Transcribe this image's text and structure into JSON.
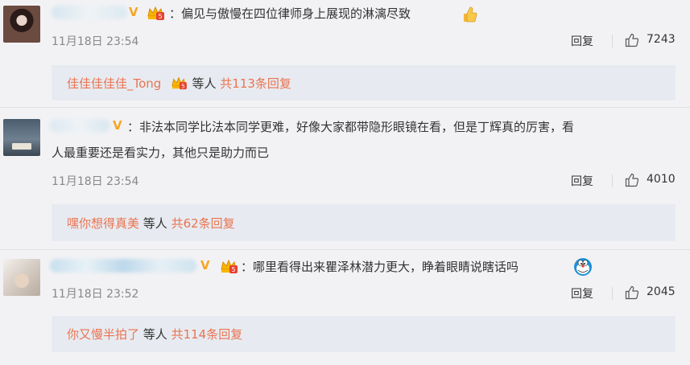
{
  "comments": [
    {
      "text": "：偏见与傲慢在四位律师身上展现的淋漓尽致",
      "time": "11月18日 23:54",
      "reply_label": "回复",
      "likes": "7243",
      "sub_user": "佳佳佳佳佳_Tong",
      "sub_mid": " 等人 ",
      "sub_count": "共113条回复",
      "emoji_icon": "thumbs-up-icon"
    },
    {
      "text_line1": "：非法本同学比法本同学更难，好像大家都带隐形眼镜在看，但是丁辉真的厉害，看",
      "text_line2": "人最重要还是看实力，其他只是助力而已",
      "time": "11月18日 23:54",
      "reply_label": "回复",
      "likes": "4010",
      "sub_user": "嘿你想得真美",
      "sub_mid": " 等人 ",
      "sub_count": "共62条回复"
    },
    {
      "text": "：哪里看得出来瞿泽林潜力更大，睁着眼睛说瞎话吗",
      "time": "11月18日 23:52",
      "reply_label": "回复",
      "likes": "2045",
      "sub_user": "你又慢半拍了",
      "sub_mid": " 等人 ",
      "sub_count": "共114条回复",
      "emoji_icon": "doraemon-icon"
    }
  ],
  "colors": {
    "link": "#eb7350",
    "subbox_bg": "#e7ebf1",
    "badge": "#f5a623"
  }
}
